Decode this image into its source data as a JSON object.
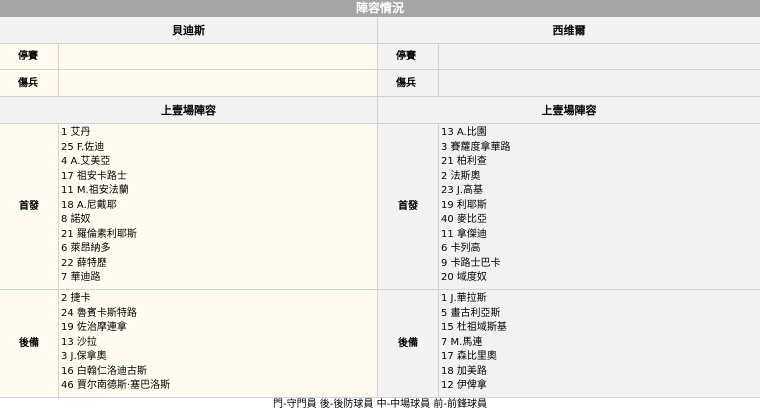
{
  "header": {
    "title": "陣容情況"
  },
  "teams": {
    "home": {
      "name": "貝迪斯",
      "suspended": "",
      "injured": "",
      "starters": [
        "1 艾丹",
        "25 F.佐迪",
        "4 A.艾美亞",
        "17 祖安卡路士",
        "11 M.祖安法蘭",
        "18 A.尼戴耶",
        "8 諾奴",
        "21 羅倫素利耶斯",
        "6 萊昂納多",
        "22 薛特歷",
        "7 華迪路"
      ],
      "subs": [
        "2 捷卡",
        "24 魯賓卡斯特路",
        "19 佐治摩連拿",
        "13 沙拉",
        "3 J.保拿奧",
        "16 白翰仁洛迪古斯",
        "46 賈尔南德斯·塞巴洛斯"
      ]
    },
    "away": {
      "name": "西维爾",
      "suspended": "",
      "injured": "",
      "starters": [
        "13 A.比園",
        "3 賽蘿度拿華路",
        "21 柏利查",
        "2 法斯奧",
        "23 J.高基",
        "19 利耶斯",
        "40 麥比亞",
        "11 拿傑迪",
        "6 卡列高",
        "9 卡路士巴卡",
        "20 域度奴"
      ],
      "subs": [
        "1 J.華拉斯",
        "5 畫古利亞斯",
        "15 杜祖域斯基",
        "7 M.馬連",
        "17 森比里奧",
        "18 加美路",
        "12 伊俾拿"
      ]
    }
  },
  "labels": {
    "suspended": "停賽",
    "injured": "傷兵",
    "last_lineup": "上壹場陣容",
    "starters": "首發",
    "subs": "後備"
  },
  "legend": "門-守門員 後-後防球員 中-中場球員 前-前鋒球員"
}
